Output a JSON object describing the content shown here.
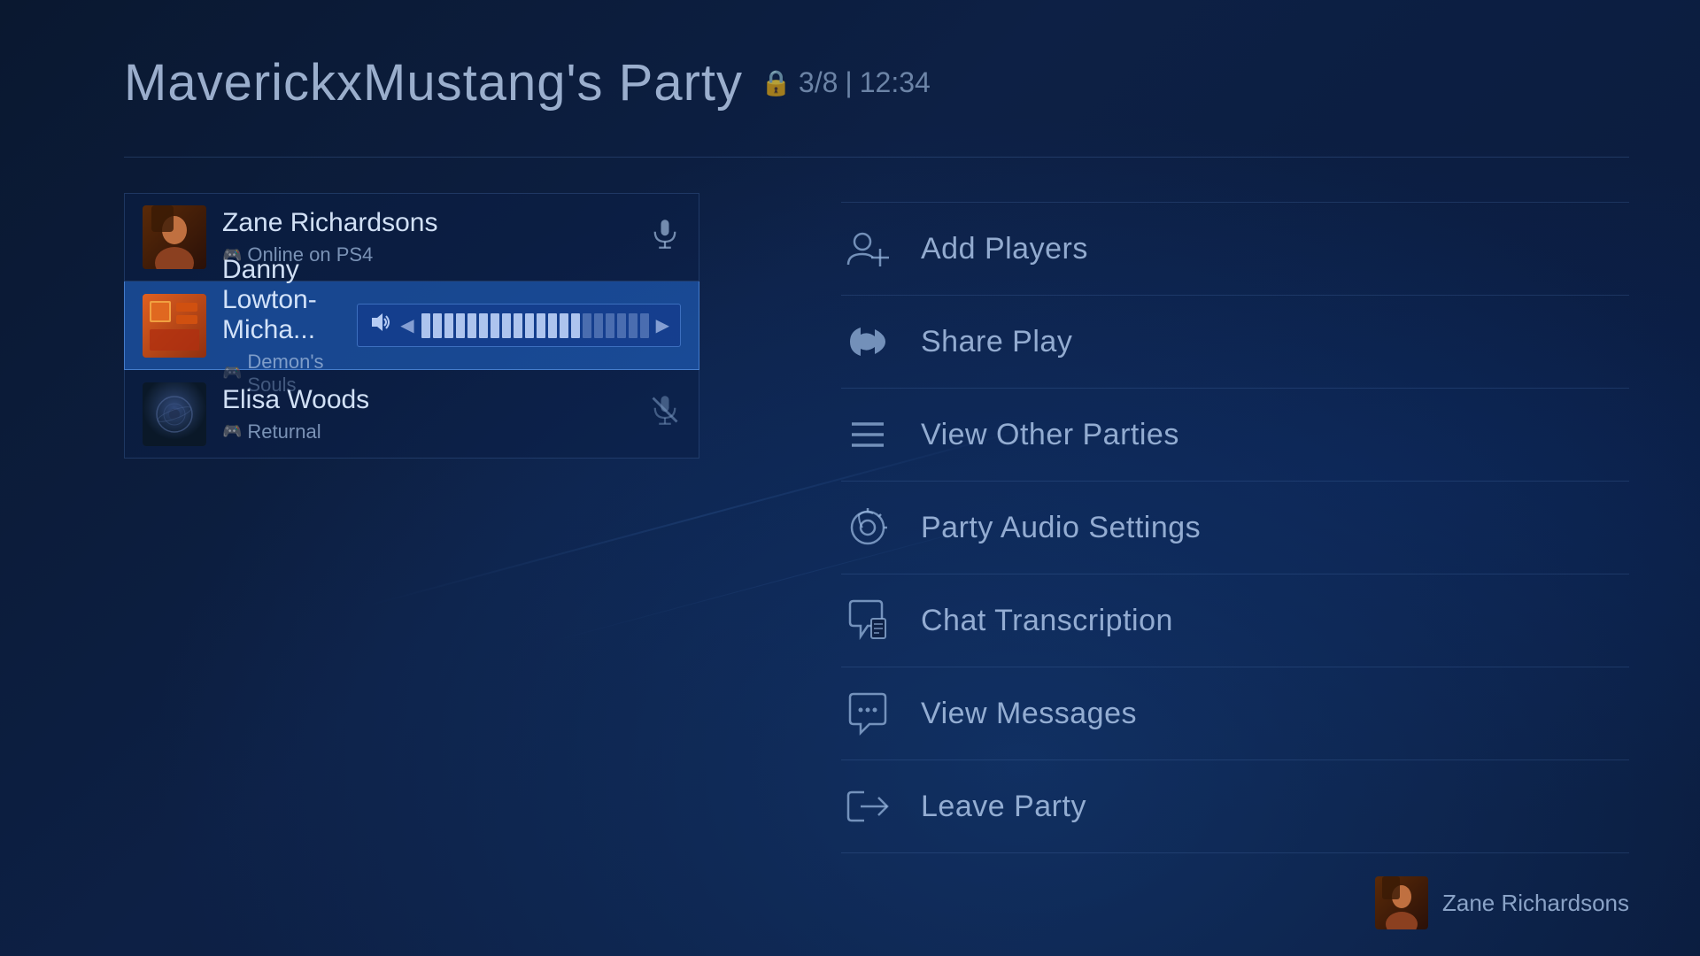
{
  "title": {
    "party_name": "MaverickxMustang's Party",
    "member_count": "3/8",
    "time": "12:34"
  },
  "members": [
    {
      "name": "Zane Richardsons",
      "status": "Online on PS4",
      "active": false,
      "muted": false,
      "avatar_color1": "#3a2010",
      "avatar_color2": "#8b4010"
    },
    {
      "name": "Danny Lowton-Micha...",
      "status": "Demon's Souls",
      "active": true,
      "muted": false,
      "avatar_color1": "#c04010",
      "avatar_color2": "#e06020"
    },
    {
      "name": "Elisa Woods",
      "status": "Returnal",
      "active": false,
      "muted": true,
      "avatar_color1": "#101828",
      "avatar_color2": "#203050"
    }
  ],
  "menu": [
    {
      "id": "add-players",
      "label": "Add Players",
      "icon": "add-player"
    },
    {
      "id": "share-play",
      "label": "Share Play",
      "icon": "share-play"
    },
    {
      "id": "view-other-parties",
      "label": "View Other Parties",
      "icon": "list"
    },
    {
      "id": "party-audio-settings",
      "label": "Party Audio Settings",
      "icon": "audio-settings"
    },
    {
      "id": "chat-transcription",
      "label": "Chat Transcription",
      "icon": "chat-transcription"
    },
    {
      "id": "view-messages",
      "label": "View Messages",
      "icon": "messages"
    },
    {
      "id": "leave-party",
      "label": "Leave Party",
      "icon": "leave"
    }
  ],
  "current_user": {
    "name": "Zane Richardsons",
    "avatar_color1": "#3a2010",
    "avatar_color2": "#8b4010"
  },
  "volume": {
    "active_bars": 14,
    "total_bars": 20
  }
}
